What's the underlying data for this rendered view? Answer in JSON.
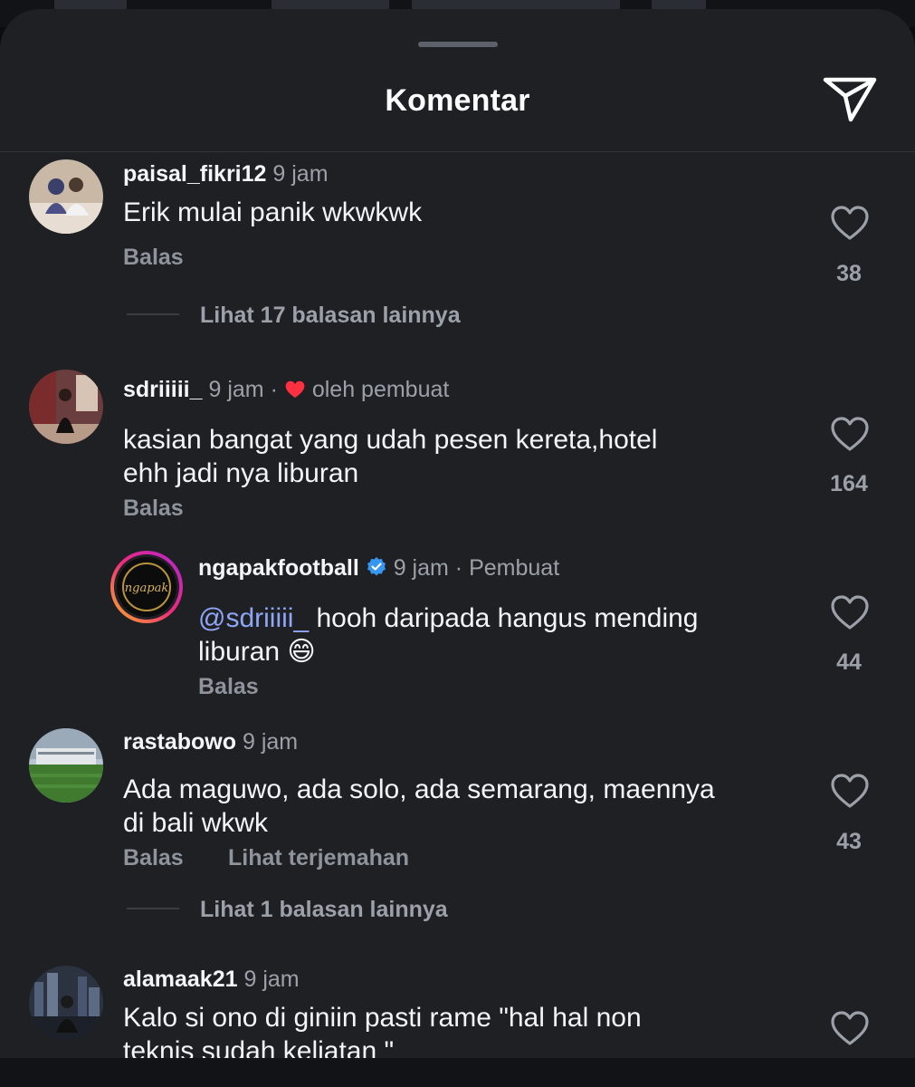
{
  "header": {
    "title": "Komentar",
    "share_icon": "send-icon"
  },
  "comments": [
    {
      "username": "paisal_fikri12",
      "time": "9 jam",
      "text": "Erik mulai panik wkwkwk",
      "reply_label": "Balas",
      "likes": "38",
      "view_replies": "Lihat 17 balasan lainnya"
    },
    {
      "username": "sdriiiii_",
      "time": "9 jam",
      "separator": "·",
      "liked_by_creator": "oleh pembuat",
      "text_line1": "kasian bangat yang udah pesen kereta,hotel",
      "text_line2": "ehh jadi nya liburan",
      "reply_label": "Balas",
      "likes": "164"
    },
    {
      "username": "ngapakfootball",
      "time": "9 jam",
      "separator": "·",
      "creator_label": "Pembuat",
      "mention": "@sdriiiii_",
      "text_rest": "hooh daripada hangus mending",
      "text_line2": "liburan",
      "emoji": "😄",
      "reply_label": "Balas",
      "likes": "44",
      "avatar_text": "ngapak"
    },
    {
      "username": "rastabowo",
      "time": "9 jam",
      "text_line1": "Ada maguwo, ada solo, ada semarang, maennya",
      "text_line2": "di bali wkwk",
      "reply_label": "Balas",
      "translate_label": "Lihat terjemahan",
      "likes": "43",
      "view_replies": "Lihat 1 balasan lainnya"
    },
    {
      "username": "alamaak21",
      "time": "9 jam",
      "text_line1": "Kalo si ono di giniin pasti rame \"hal hal non",
      "text_line2": "teknis sudah keliatan \""
    }
  ],
  "colors": {
    "sheet": "#1e2024",
    "text": "#f3f5f7",
    "muted": "#9ca1a9",
    "mention": "#8fa6f5",
    "verified": "#3797f0",
    "heart_red": "#ff3040"
  }
}
